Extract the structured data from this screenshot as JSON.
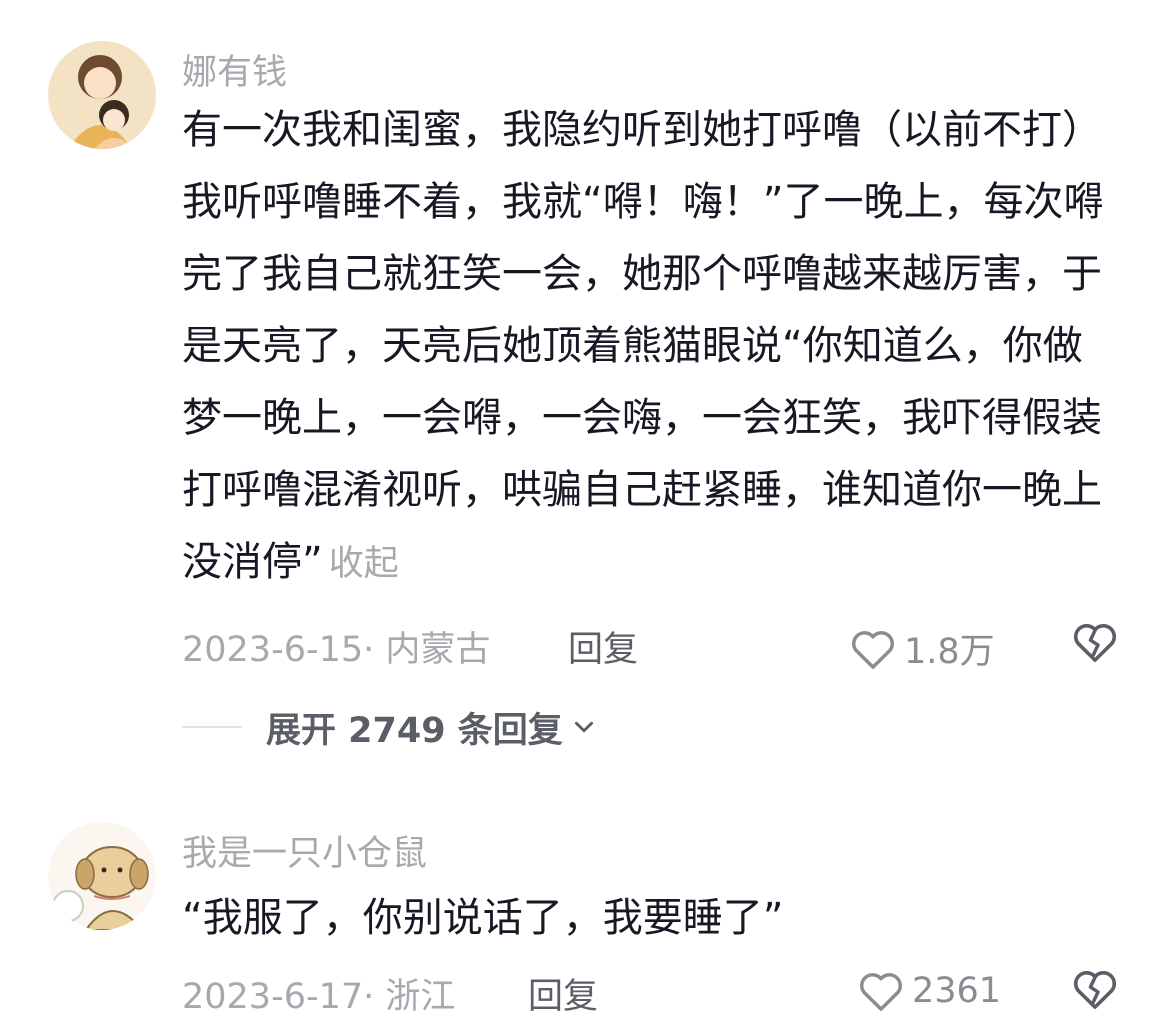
{
  "comments": [
    {
      "username": "娜有钱",
      "text": "有一次我和闺蜜，我隐约听到她打呼噜（以前不打）我听呼噜睡不着，我就“嘚！嗨！”了一晚上，每次嘚完了我自己就狂笑一会，她那个呼噜越来越厉害，于是天亮了，天亮后她顶着熊猫眼说“你知道么，你做梦一晚上，一会嘚，一会嗨，一会狂笑，我吓得假装打呼噜混淆视听，哄骗自己赶紧睡，谁知道你一晚上没消停”",
      "collapse_label": "收起",
      "date": "2023-6-15",
      "location": "内蒙古",
      "reply_label": "回复",
      "likes": "1.8万",
      "expand_label": "展开 2749 条回复"
    },
    {
      "username": "我是一只小仓鼠",
      "text": "“我服了，你别说话了，我要睡了”",
      "date": "2023-6-17",
      "location": "浙江",
      "reply_label": "回复",
      "likes": "2361"
    }
  ],
  "icons": {
    "like": "heart-outline-icon",
    "dislike": "broken-heart-icon",
    "expand": "chevron-down-icon"
  },
  "colors": {
    "text": "#161823",
    "muted": "#a7a9ae",
    "secondary": "#5b5e66"
  }
}
